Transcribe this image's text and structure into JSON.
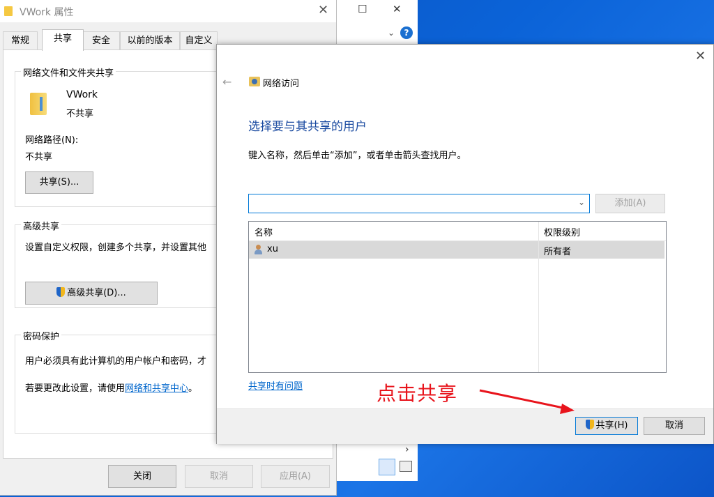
{
  "props_dialog": {
    "title": "VWork 属性",
    "tabs": [
      "常规",
      "共享",
      "安全",
      "以前的版本",
      "自定义"
    ],
    "network_group": {
      "title": "网络文件和文件夹共享",
      "folder_name": "VWork",
      "folder_status": "不共享",
      "path_label": "网络路径(N):",
      "path_value": "不共享",
      "share_button": "共享(S)..."
    },
    "advanced_group": {
      "title": "高级共享",
      "description": "设置自定义权限，创建多个共享，并设置其他",
      "button": "高级共享(D)..."
    },
    "password_group": {
      "title": "密码保护",
      "description": "用户必须具有此计算机的用户帐户和密码，才",
      "change_prefix": "若要更改此设置，请使用",
      "change_link": "网络和共享中心",
      "change_suffix": "。"
    },
    "buttons": {
      "close": "关闭",
      "cancel": "取消",
      "apply": "应用(A)"
    }
  },
  "share_dialog": {
    "nav_title": "网络访问",
    "heading": "选择要与其共享的用户",
    "instruction": "键入名称，然后单击“添加”，或者单击箭头查找用户。",
    "combo_value": "",
    "add_button": "添加(A)",
    "table": {
      "headers": [
        "名称",
        "权限级别"
      ],
      "rows": [
        {
          "name": "xu",
          "level": "所有者"
        }
      ]
    },
    "trouble_link": "共享时有问题",
    "buttons": {
      "share": "共享(H)",
      "cancel": "取消"
    }
  },
  "annotation": "点击共享",
  "colors": {
    "annotation": "#e8141c",
    "heading": "#1a4aa0",
    "link": "#0066cc"
  }
}
